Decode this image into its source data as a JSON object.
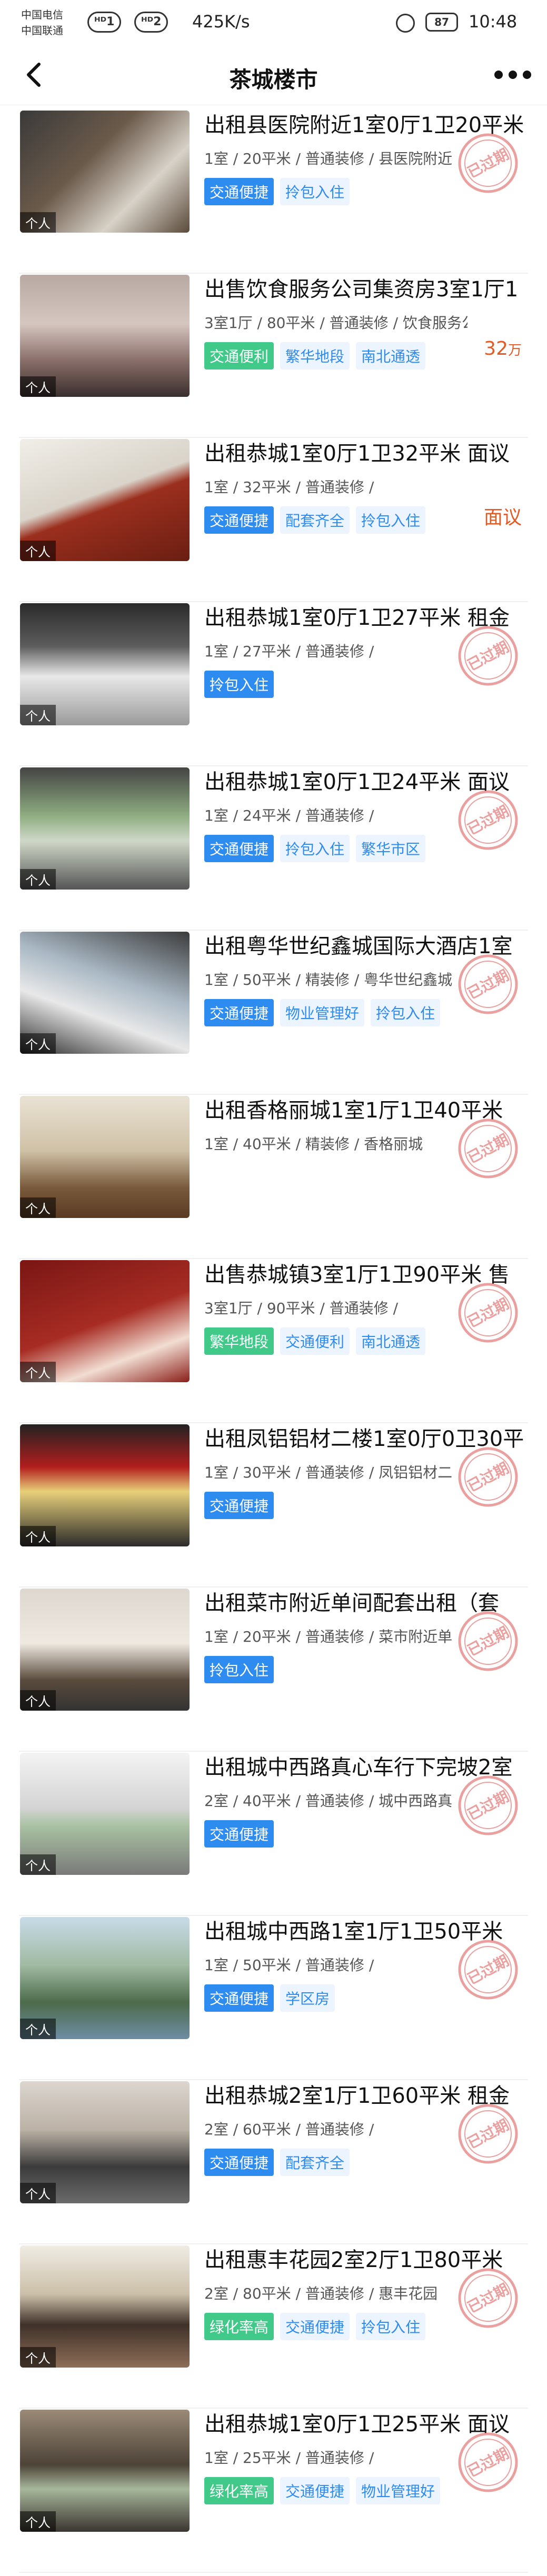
{
  "status_bar": {
    "carrier1": "中国电信",
    "carrier2": "中国联通",
    "signal1": "ᴴᴰ1",
    "signal2": "ᴴᴰ2",
    "speed": "425K/s",
    "battery": "87",
    "time": "10:48"
  },
  "nav": {
    "title": "茶城楼市"
  },
  "stamp_text": "已过期",
  "listings": [
    {
      "title": "出租县医院附近1室0厅1卫20平米",
      "meta": "1室 / 20平米 / 普通装修 / 县医院附近",
      "tags": [
        "交通便捷",
        "拎包入住"
      ],
      "price": "",
      "unit": "",
      "stamp": true,
      "badge": "个人"
    },
    {
      "title": "出售饮食服务公司集资房3室1厅1",
      "meta": "3室1厅 / 80平米 / 普通装修 / 饮食服务公",
      "tags": [
        "交通便利",
        "繁华地段",
        "南北通透"
      ],
      "price": "32",
      "unit": "万",
      "stamp": false,
      "badge": "个人"
    },
    {
      "title": "出租恭城1室0厅1卫32平米 面议",
      "meta": "1室 / 32平米 / 普通装修 /",
      "tags": [
        "交通便捷",
        "配套齐全",
        "拎包入住"
      ],
      "price": "面议",
      "unit": "",
      "stamp": false,
      "badge": "个人"
    },
    {
      "title": "出租恭城1室0厅1卫27平米 租金",
      "meta": "1室 / 27平米 / 普通装修 /",
      "tags": [
        "拎包入住"
      ],
      "price": "",
      "unit": "",
      "stamp": true,
      "badge": "个人"
    },
    {
      "title": "出租恭城1室0厅1卫24平米 面议",
      "meta": "1室 / 24平米 / 普通装修 /",
      "tags": [
        "交通便捷",
        "拎包入住",
        "繁华市区"
      ],
      "price": "",
      "unit": "",
      "stamp": true,
      "badge": "个人"
    },
    {
      "title": "出租粤华世纪鑫城国际大酒店1室",
      "meta": "1室 / 50平米 / 精装修 / 粤华世纪鑫城",
      "tags": [
        "交通便捷",
        "物业管理好",
        "拎包入住"
      ],
      "price": "",
      "unit": "",
      "stamp": true,
      "badge": "个人"
    },
    {
      "title": "出租香格丽城1室1厅1卫40平米",
      "meta": "1室 / 40平米 / 精装修 / 香格丽城",
      "tags": [],
      "price": "",
      "unit": "",
      "stamp": true,
      "badge": "个人"
    },
    {
      "title": "出售恭城镇3室1厅1卫90平米 售",
      "meta": "3室1厅 / 90平米 / 普通装修 /",
      "tags": [
        "繁华地段",
        "交通便利",
        "南北通透"
      ],
      "price": "",
      "unit": "",
      "stamp": true,
      "badge": "个人"
    },
    {
      "title": "出租凤铝铝材二楼1室0厅0卫30平",
      "meta": "1室 / 30平米 / 普通装修 / 凤铝铝材二",
      "tags": [
        "交通便捷"
      ],
      "price": "",
      "unit": "",
      "stamp": true,
      "badge": "个人"
    },
    {
      "title": "出租菜市附近单间配套出租（套",
      "meta": "1室 / 20平米 / 普通装修 / 菜市附近单",
      "tags": [
        "拎包入住"
      ],
      "price": "",
      "unit": "",
      "stamp": true,
      "badge": "个人"
    },
    {
      "title": "出租城中西路真心车行下完坡2室",
      "meta": "2室 / 40平米 / 普通装修 / 城中西路真",
      "tags": [
        "交通便捷"
      ],
      "price": "",
      "unit": "",
      "stamp": true,
      "badge": "个人"
    },
    {
      "title": "出租城中西路1室1厅1卫50平米",
      "meta": "1室 / 50平米 / 普通装修 /",
      "tags": [
        "交通便捷",
        "学区房"
      ],
      "price": "",
      "unit": "",
      "stamp": true,
      "badge": "个人"
    },
    {
      "title": "出租恭城2室1厅1卫60平米 租金",
      "meta": "2室 / 60平米 / 普通装修 /",
      "tags": [
        "交通便捷",
        "配套齐全"
      ],
      "price": "",
      "unit": "",
      "stamp": true,
      "badge": "个人"
    },
    {
      "title": "出租惠丰花园2室2厅1卫80平米",
      "meta": "2室 / 80平米 / 普通装修 / 惠丰花园",
      "tags": [
        "绿化率高",
        "交通便捷",
        "拎包入住"
      ],
      "price": "",
      "unit": "",
      "stamp": true,
      "badge": "个人"
    },
    {
      "title": "出租恭城1室0厅1卫25平米 面议",
      "meta": "1室 / 25平米 / 普通装修 /",
      "tags": [
        "绿化率高",
        "交通便捷",
        "物业管理好"
      ],
      "price": "",
      "unit": "",
      "stamp": true,
      "badge": "个人"
    }
  ],
  "colors": {
    "accent": "#2e8bf0",
    "accent_light": "#ecf4ff",
    "green": "#41c98a",
    "price": "#e55a22",
    "stamp": "#d9534f"
  }
}
